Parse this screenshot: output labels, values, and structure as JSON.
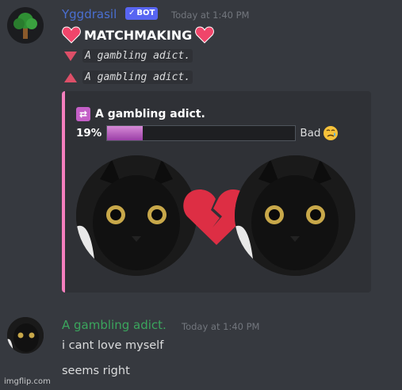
{
  "bot_message": {
    "username": "Yggdrasil",
    "bot_tag": "BOT",
    "timestamp": "Today at 1:40 PM",
    "title": "MATCHMAKING",
    "lines": [
      {
        "arrow": "down",
        "text": "A gambling adict."
      },
      {
        "arrow": "up",
        "text": "A gambling adict."
      }
    ],
    "embed": {
      "title": "A gambling adict.",
      "percent_label": "19%",
      "percent_value": 0.19,
      "verdict": "Bad",
      "accent_color": "#f47fbe"
    }
  },
  "user_message": {
    "username": "A gambling adict.",
    "timestamp": "Today at 1:40 PM",
    "lines": [
      "i cant love myself",
      "seems right"
    ]
  },
  "watermark": "imgflip.com",
  "colors": {
    "background": "#36393f",
    "bot_name": "#4a6fd1",
    "user_name": "#3ba55d",
    "heart": "#f0456a",
    "arrow": "#dd4f68",
    "bar_fill": "#b65cc0"
  }
}
